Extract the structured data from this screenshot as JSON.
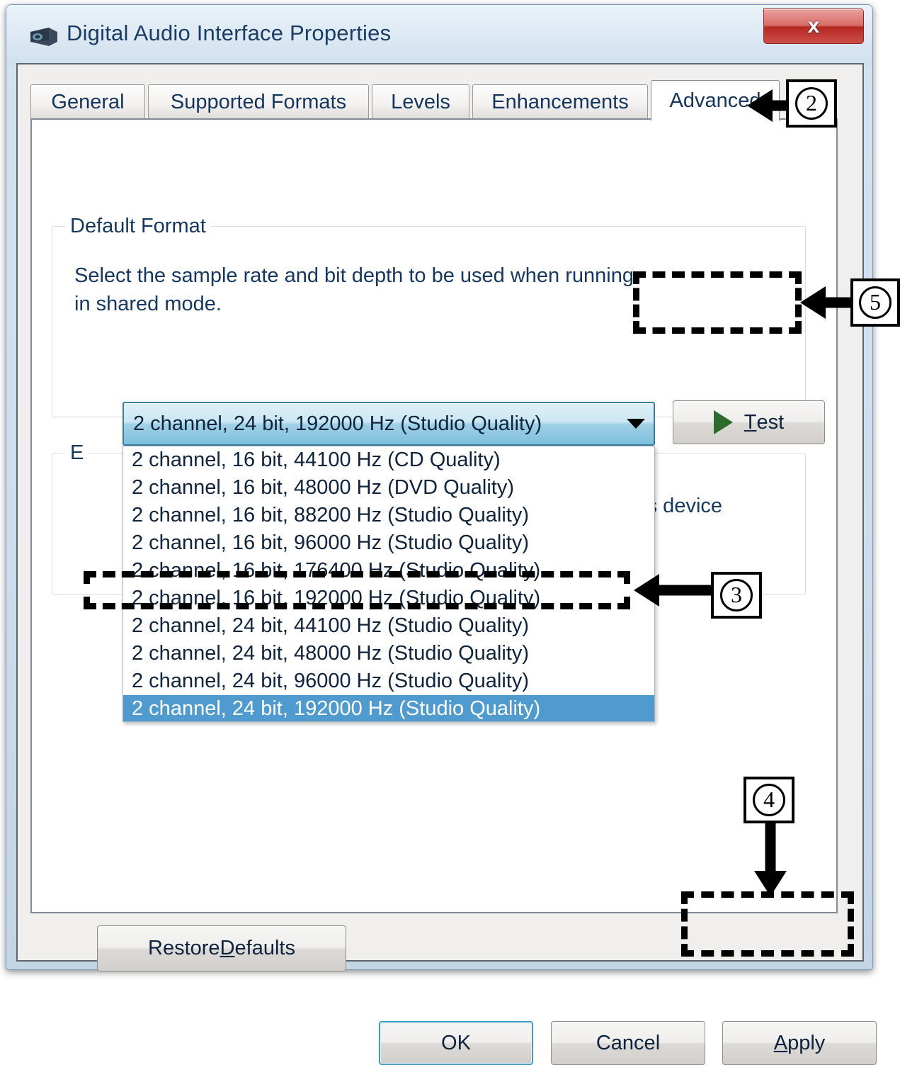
{
  "window": {
    "title": "Digital Audio Interface Properties",
    "icon": "audio-device-icon",
    "close_label": "x"
  },
  "tabs": [
    {
      "label": "General",
      "active": false
    },
    {
      "label": "Supported Formats",
      "active": false
    },
    {
      "label": "Levels",
      "active": false
    },
    {
      "label": "Enhancements",
      "active": false
    },
    {
      "label": "Advanced",
      "active": true
    }
  ],
  "default_format": {
    "group_label": "Default Format",
    "description_line1": "Select the sample rate and bit depth to be used when running",
    "description_line2": "in shared mode.",
    "selected_value": "2 channel, 24 bit, 192000 Hz (Studio Quality)",
    "test_button": {
      "prefix": "T",
      "rest": "est"
    },
    "options": [
      "2 channel, 16 bit, 44100 Hz (CD Quality)",
      "2 channel, 16 bit, 48000 Hz (DVD Quality)",
      "2 channel, 16 bit, 88200 Hz (Studio Quality)",
      "2 channel, 16 bit, 96000 Hz (Studio Quality)",
      "2 channel, 16 bit, 176400 Hz (Studio Quality)",
      "2 channel, 16 bit, 192000 Hz (Studio Quality)",
      "2 channel, 24 bit, 44100 Hz (Studio Quality)",
      "2 channel, 24 bit, 48000 Hz (Studio Quality)",
      "2 channel, 24 bit, 96000 Hz (Studio Quality)",
      "2 channel, 24 bit, 192000 Hz (Studio Quality)"
    ],
    "selected_index": 9
  },
  "exclusive_mode": {
    "group_label_visible": "E",
    "text_fragment_visible": "this device"
  },
  "buttons": {
    "restore_defaults": {
      "prefix": "Restore ",
      "accel": "D",
      "rest": "efaults"
    },
    "ok": "OK",
    "cancel": "Cancel",
    "apply": {
      "accel": "A",
      "rest": "pply"
    }
  },
  "annotations": {
    "badge_2": "2",
    "badge_3": "3",
    "badge_4": "4",
    "badge_5": "5"
  },
  "colors": {
    "frame": "#cfdfee",
    "title_text": "#1a3d66",
    "close_red": "#b62722",
    "combo_blue": "#7fc0de",
    "selection_blue": "#4f9bd0",
    "play_green": "#2d6b2d",
    "focus_ring": "#3c9cc8"
  }
}
